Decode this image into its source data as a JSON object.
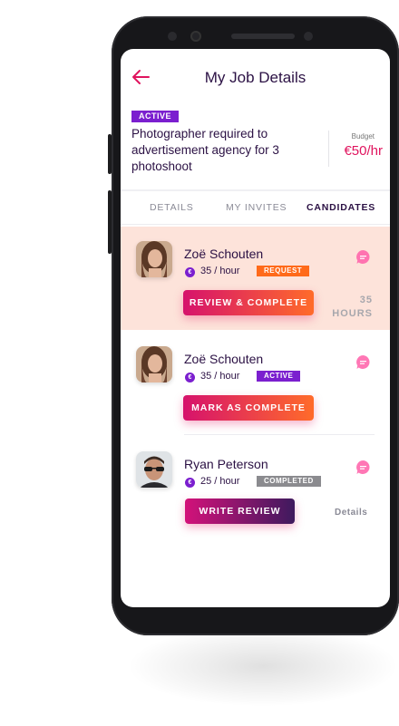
{
  "header": {
    "title": "My Job Details"
  },
  "job": {
    "status": "ACTIVE",
    "title": "Photographer required to advertisement agency for 3 photoshoot",
    "budget_label": "Budget",
    "budget_value": "€50/hr"
  },
  "tabs": [
    {
      "label": "DETAILS",
      "active": false
    },
    {
      "label": "MY INVITES",
      "active": false
    },
    {
      "label": "CANDIDATES",
      "active": true
    }
  ],
  "candidates": [
    {
      "name": "Zoë Schouten",
      "rate": "35 / hour",
      "status": "REQUEST",
      "action": "REVIEW & COMPLETE",
      "hours_value": "35",
      "hours_unit": "HOURS",
      "highlighted": true
    },
    {
      "name": "Zoë Schouten",
      "rate": "35 / hour",
      "status": "ACTIVE",
      "action": "MARK AS COMPLETE"
    },
    {
      "name": "Ryan Peterson",
      "rate": "25 / hour",
      "status": "COMPLETED",
      "action": "WRITE REVIEW",
      "details_label": "Details"
    }
  ],
  "colors": {
    "accent": "#e0145e",
    "purple": "#7b1fcf",
    "dark": "#2b1144",
    "highlight_bg": "#fde3da"
  },
  "icons": {
    "back": "arrow-left-icon",
    "chat": "chat-bubble-icon",
    "currency": "euro-icon"
  }
}
